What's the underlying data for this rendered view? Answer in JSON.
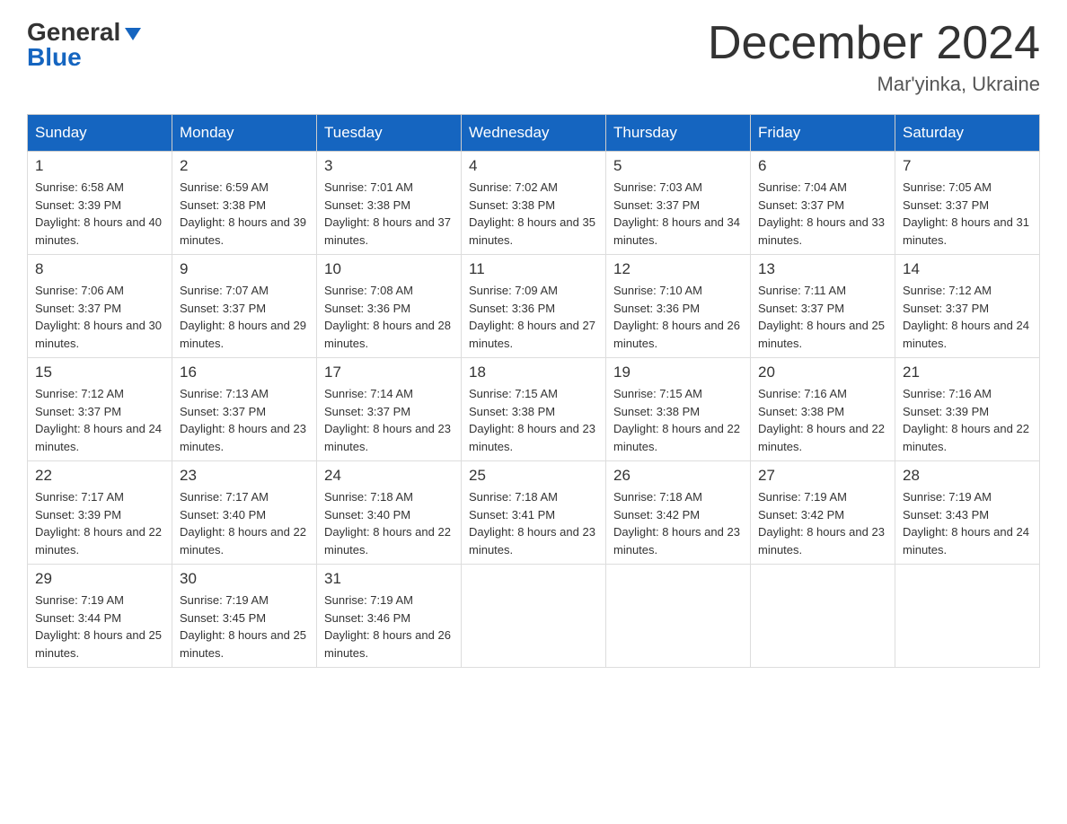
{
  "header": {
    "logo_general": "General",
    "logo_blue": "Blue",
    "month_year": "December 2024",
    "location": "Mar'yinka, Ukraine"
  },
  "days_of_week": [
    "Sunday",
    "Monday",
    "Tuesday",
    "Wednesday",
    "Thursday",
    "Friday",
    "Saturday"
  ],
  "weeks": [
    [
      {
        "day": "1",
        "sunrise": "6:58 AM",
        "sunset": "3:39 PM",
        "daylight": "8 hours and 40 minutes."
      },
      {
        "day": "2",
        "sunrise": "6:59 AM",
        "sunset": "3:38 PM",
        "daylight": "8 hours and 39 minutes."
      },
      {
        "day": "3",
        "sunrise": "7:01 AM",
        "sunset": "3:38 PM",
        "daylight": "8 hours and 37 minutes."
      },
      {
        "day": "4",
        "sunrise": "7:02 AM",
        "sunset": "3:38 PM",
        "daylight": "8 hours and 35 minutes."
      },
      {
        "day": "5",
        "sunrise": "7:03 AM",
        "sunset": "3:37 PM",
        "daylight": "8 hours and 34 minutes."
      },
      {
        "day": "6",
        "sunrise": "7:04 AM",
        "sunset": "3:37 PM",
        "daylight": "8 hours and 33 minutes."
      },
      {
        "day": "7",
        "sunrise": "7:05 AM",
        "sunset": "3:37 PM",
        "daylight": "8 hours and 31 minutes."
      }
    ],
    [
      {
        "day": "8",
        "sunrise": "7:06 AM",
        "sunset": "3:37 PM",
        "daylight": "8 hours and 30 minutes."
      },
      {
        "day": "9",
        "sunrise": "7:07 AM",
        "sunset": "3:37 PM",
        "daylight": "8 hours and 29 minutes."
      },
      {
        "day": "10",
        "sunrise": "7:08 AM",
        "sunset": "3:36 PM",
        "daylight": "8 hours and 28 minutes."
      },
      {
        "day": "11",
        "sunrise": "7:09 AM",
        "sunset": "3:36 PM",
        "daylight": "8 hours and 27 minutes."
      },
      {
        "day": "12",
        "sunrise": "7:10 AM",
        "sunset": "3:36 PM",
        "daylight": "8 hours and 26 minutes."
      },
      {
        "day": "13",
        "sunrise": "7:11 AM",
        "sunset": "3:37 PM",
        "daylight": "8 hours and 25 minutes."
      },
      {
        "day": "14",
        "sunrise": "7:12 AM",
        "sunset": "3:37 PM",
        "daylight": "8 hours and 24 minutes."
      }
    ],
    [
      {
        "day": "15",
        "sunrise": "7:12 AM",
        "sunset": "3:37 PM",
        "daylight": "8 hours and 24 minutes."
      },
      {
        "day": "16",
        "sunrise": "7:13 AM",
        "sunset": "3:37 PM",
        "daylight": "8 hours and 23 minutes."
      },
      {
        "day": "17",
        "sunrise": "7:14 AM",
        "sunset": "3:37 PM",
        "daylight": "8 hours and 23 minutes."
      },
      {
        "day": "18",
        "sunrise": "7:15 AM",
        "sunset": "3:38 PM",
        "daylight": "8 hours and 23 minutes."
      },
      {
        "day": "19",
        "sunrise": "7:15 AM",
        "sunset": "3:38 PM",
        "daylight": "8 hours and 22 minutes."
      },
      {
        "day": "20",
        "sunrise": "7:16 AM",
        "sunset": "3:38 PM",
        "daylight": "8 hours and 22 minutes."
      },
      {
        "day": "21",
        "sunrise": "7:16 AM",
        "sunset": "3:39 PM",
        "daylight": "8 hours and 22 minutes."
      }
    ],
    [
      {
        "day": "22",
        "sunrise": "7:17 AM",
        "sunset": "3:39 PM",
        "daylight": "8 hours and 22 minutes."
      },
      {
        "day": "23",
        "sunrise": "7:17 AM",
        "sunset": "3:40 PM",
        "daylight": "8 hours and 22 minutes."
      },
      {
        "day": "24",
        "sunrise": "7:18 AM",
        "sunset": "3:40 PM",
        "daylight": "8 hours and 22 minutes."
      },
      {
        "day": "25",
        "sunrise": "7:18 AM",
        "sunset": "3:41 PM",
        "daylight": "8 hours and 23 minutes."
      },
      {
        "day": "26",
        "sunrise": "7:18 AM",
        "sunset": "3:42 PM",
        "daylight": "8 hours and 23 minutes."
      },
      {
        "day": "27",
        "sunrise": "7:19 AM",
        "sunset": "3:42 PM",
        "daylight": "8 hours and 23 minutes."
      },
      {
        "day": "28",
        "sunrise": "7:19 AM",
        "sunset": "3:43 PM",
        "daylight": "8 hours and 24 minutes."
      }
    ],
    [
      {
        "day": "29",
        "sunrise": "7:19 AM",
        "sunset": "3:44 PM",
        "daylight": "8 hours and 25 minutes."
      },
      {
        "day": "30",
        "sunrise": "7:19 AM",
        "sunset": "3:45 PM",
        "daylight": "8 hours and 25 minutes."
      },
      {
        "day": "31",
        "sunrise": "7:19 AM",
        "sunset": "3:46 PM",
        "daylight": "8 hours and 26 minutes."
      },
      null,
      null,
      null,
      null
    ]
  ],
  "colors": {
    "header_bg": "#1565c0",
    "header_text": "#ffffff",
    "logo_blue": "#1565c0"
  }
}
